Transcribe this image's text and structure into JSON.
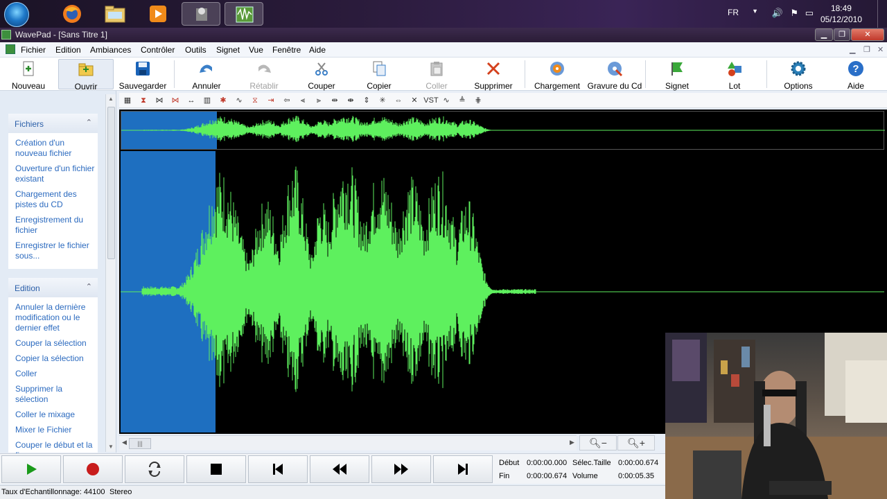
{
  "taskbar": {
    "language": "FR",
    "time": "18:49",
    "date": "05/12/2010"
  },
  "window": {
    "title": "WavePad - [Sans Titre 1]"
  },
  "menu": [
    "Fichier",
    "Edition",
    "Ambiances",
    "Contrôler",
    "Outils",
    "Signet",
    "Vue",
    "Fenêtre",
    "Aide"
  ],
  "toolbar": {
    "nouveau": "Nouveau",
    "ouvrir": "Ouvrir",
    "sauvegarder": "Sauvegarder",
    "annuler": "Annuler",
    "retablir": "Rétablir",
    "couper": "Couper",
    "copier": "Copier",
    "coller": "Coller",
    "supprimer": "Supprimer",
    "chargement": "Chargement",
    "gravure": "Gravure du Cd",
    "signet": "Signet",
    "lot": "Lot",
    "options": "Options",
    "aide": "Aide"
  },
  "sidebar": {
    "fichiers": {
      "title": "Fichiers",
      "links": [
        "Création d'un nouveau fichier",
        "Ouverture d'un fichier existant",
        "Chargement des pistes du CD",
        "Enregistrement du fichier",
        "Enregistrer le fichier sous..."
      ]
    },
    "edition": {
      "title": "Edition",
      "links": [
        "Annuler la dernière modification ou le dernier effet",
        "Couper la sélection",
        "Copier la sélection",
        "Coller",
        "Supprimer la sélection",
        "Coller le mixage",
        "Mixer le Fichier",
        "Couper le début et la fin"
      ]
    }
  },
  "fx_toolbar": {
    "vst_label": "VST"
  },
  "selection": {
    "debut_label": "Début",
    "debut_value": "0:00:00.000",
    "fin_label": "Fin",
    "fin_value": "0:00:00.674",
    "taille_label": "Sélec.Taille",
    "taille_value": "0:00:00.674",
    "volume_label": "Volume",
    "volume_value": "0:00:05.35"
  },
  "status": {
    "sample_rate": "Taux d'Echantillonnage: 44100",
    "channels": "Stereo"
  },
  "colors": {
    "waveform": "#5ef05e",
    "selection": "#1e6fc0",
    "link": "#2b6abf"
  }
}
